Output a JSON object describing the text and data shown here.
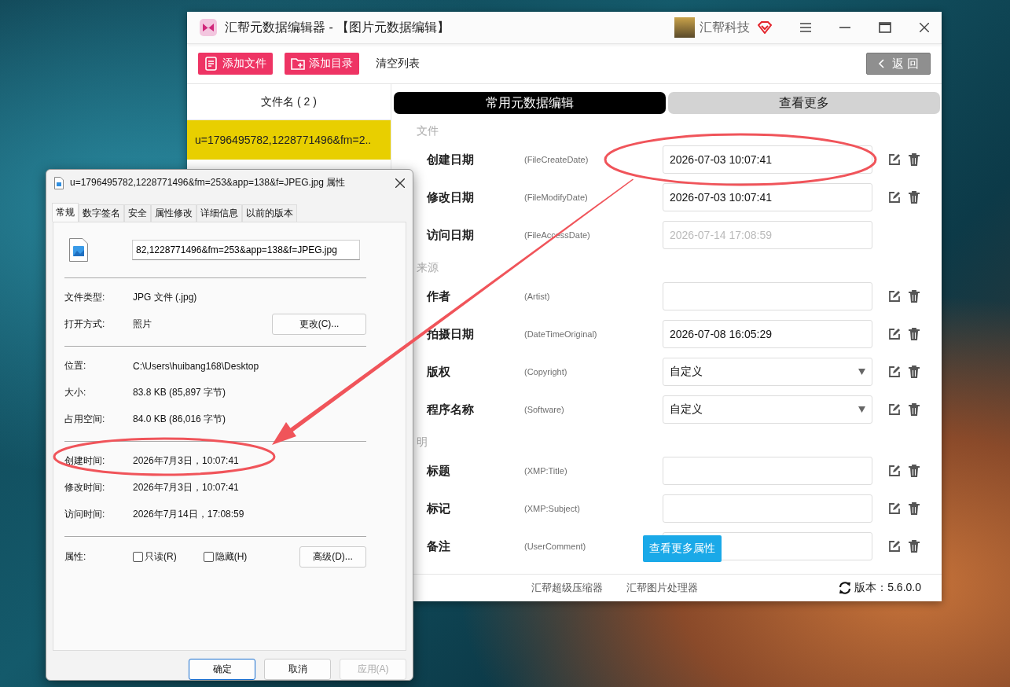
{
  "app": {
    "title": "汇帮元数据编辑器 - 【图片元数据编辑】",
    "brand": "汇帮科技",
    "toolbar": [
      {
        "kind": "add-file",
        "label": "添加文件"
      },
      {
        "kind": "add-folder",
        "label": "添加目录"
      },
      {
        "kind": "plain",
        "label": "清空列表"
      }
    ],
    "back_label": "返 回",
    "file_list": {
      "header": "文件名 ( 2 )",
      "items": [
        {
          "name": "u=1796495782,1228771496&fm=2..",
          "selected": true
        }
      ]
    },
    "tabs": [
      {
        "label": "常用元数据编辑",
        "selected": true
      },
      {
        "label": "查看更多",
        "selected": false
      }
    ],
    "sections": [
      {
        "title": "文件",
        "fields": [
          {
            "label": "创建日期",
            "tag": "(FileCreateDate)",
            "kind": "text",
            "value": "2026-07-03 10:07:41"
          },
          {
            "label": "修改日期",
            "tag": "(FileModifyDate)",
            "kind": "text",
            "value": "2026-07-03 10:07:41"
          },
          {
            "label": "访问日期",
            "tag": "(FileAccessDate)",
            "kind": "readonly",
            "placeholder": "2026-07-14 17:08:59"
          }
        ]
      },
      {
        "title": "来源",
        "fields": [
          {
            "label": "作者",
            "tag": "(Artist)",
            "kind": "text"
          },
          {
            "label": "拍摄日期",
            "tag": "(DateTimeOriginal)",
            "kind": "text",
            "value": "2026-07-08 16:05:29"
          },
          {
            "label": "版权",
            "tag": "(Copyright)",
            "kind": "select",
            "value": "自定义"
          },
          {
            "label": "程序名称",
            "tag": "(Software)",
            "kind": "select",
            "value": "自定义"
          }
        ]
      },
      {
        "title": "明",
        "fields": [
          {
            "label": "标题",
            "tag": "(XMP:Title)",
            "kind": "text"
          },
          {
            "label": "标记",
            "tag": "(XMP:Subject)",
            "kind": "text"
          },
          {
            "label": "备注",
            "tag": "(UserComment)",
            "kind": "text"
          }
        ]
      }
    ],
    "float_button": "查看更多属性",
    "footer": {
      "links": [
        "汇帮超级压缩器",
        "汇帮图片处理器"
      ],
      "version": "版本：5.6.0.0"
    }
  },
  "dialog": {
    "title": "u=1796495782,1228771496&fm=253&app=138&f=JPEG.jpg 属性",
    "tabs": [
      {
        "label": "常规",
        "selected": true
      },
      {
        "label": "数字签名",
        "selected": false
      },
      {
        "label": "安全",
        "selected": false
      },
      {
        "label": "属性修改",
        "selected": false
      },
      {
        "label": "详细信息",
        "selected": false
      },
      {
        "label": "以前的版本",
        "selected": false
      }
    ],
    "filename": "82,1228771496&fm=253&app=138&f=JPEG.jpg",
    "groups": [
      [
        {
          "label": "文件类型:",
          "value": "JPG 文件 (.jpg)"
        },
        {
          "label": "打开方式:",
          "value": "照片",
          "button": "更改(C)..."
        }
      ],
      [
        {
          "label": "位置:",
          "value": "C:\\Users\\huibang168\\Desktop"
        },
        {
          "label": "大小:",
          "value": "83.8 KB (85,897 字节)"
        },
        {
          "label": "占用空间:",
          "value": "84.0 KB (86,016 字节)"
        }
      ],
      [
        {
          "label": "创建时间:",
          "value": "2026年7月3日，10:07:41"
        },
        {
          "label": "修改时间:",
          "value": "2026年7月3日，10:07:41"
        },
        {
          "label": "访问时间:",
          "value": "2026年7月14日，17:08:59"
        }
      ]
    ],
    "attr_label": "属性:",
    "attributes": [
      {
        "label": "只读(R)",
        "checked": false
      },
      {
        "label": "隐藏(H)",
        "checked": false
      }
    ],
    "advanced_button": "高级(D)...",
    "buttons": [
      {
        "label": "确定",
        "kind": "default",
        "disabled": false
      },
      {
        "label": "取消",
        "kind": "normal",
        "disabled": false
      },
      {
        "label": "应用(A)",
        "kind": "normal",
        "disabled": true
      }
    ]
  }
}
